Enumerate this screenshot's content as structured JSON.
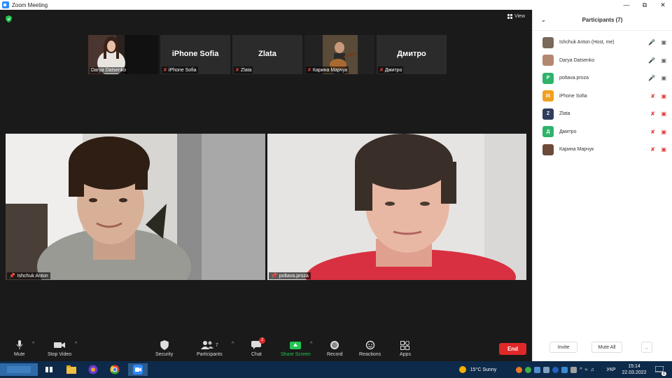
{
  "window": {
    "title": "Zoom Meeting"
  },
  "meeting": {
    "view_label": "View",
    "thumbnails": [
      {
        "big": "",
        "label": "Darya Datsenko",
        "muted": false,
        "type": "video-girl"
      },
      {
        "big": "iPhone Sofia",
        "label": "iPhone Sofia",
        "muted": true,
        "type": "name"
      },
      {
        "big": "Zlata",
        "label": "Zlata",
        "muted": true,
        "type": "name"
      },
      {
        "big": "",
        "label": "Карина Марчук",
        "muted": true,
        "type": "video-guitar"
      },
      {
        "big": "Дмитро",
        "label": "Дмитро",
        "muted": true,
        "type": "name"
      }
    ],
    "tiles": [
      {
        "label": "Ishchuk Anton"
      },
      {
        "label": "poltava.proza"
      }
    ]
  },
  "toolbar": {
    "mute": "Mute",
    "stop_video": "Stop Video",
    "security": "Security",
    "participants": "Participants",
    "participants_count": "7",
    "chat": "Chat",
    "chat_badge": "2",
    "share": "Share Screen",
    "record": "Record",
    "reactions": "Reactions",
    "apps": "Apps",
    "end": "End"
  },
  "panel": {
    "title": "Participants (7)",
    "participants": [
      {
        "name": "Ishchuk Anton (Host, me)",
        "initials": "",
        "color": "#7a6a5a",
        "mic_off": false,
        "cam_off": false
      },
      {
        "name": "Darya Datsenko",
        "initials": "",
        "color": "#b48870",
        "mic_off": false,
        "cam_off": false
      },
      {
        "name": "poltava.proza",
        "initials": "P",
        "color": "#2fb36b",
        "mic_off": false,
        "cam_off": false
      },
      {
        "name": "iPhone Sofia",
        "initials": "IS",
        "color": "#f0a020",
        "mic_off": true,
        "cam_off": true
      },
      {
        "name": "Zlata",
        "initials": "Z",
        "color": "#2e3e5c",
        "mic_off": true,
        "cam_off": true
      },
      {
        "name": "Дмитро",
        "initials": "Д",
        "color": "#2fb36b",
        "mic_off": true,
        "cam_off": true
      },
      {
        "name": "Карина Марчук",
        "initials": "",
        "color": "#6b4a3a",
        "mic_off": true,
        "cam_off": true
      }
    ],
    "invite": "Invite",
    "mute_all": "Mute All",
    "more": ".."
  },
  "taskbar": {
    "weather": "15°C  Sunny",
    "lang": "УКР",
    "time": "15:14",
    "date": "22.03.2022",
    "notif_count": "1"
  }
}
